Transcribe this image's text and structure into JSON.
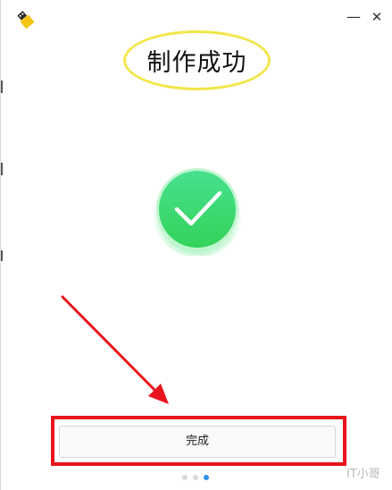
{
  "window": {
    "minimize_glyph": "—",
    "close_glyph": "✕",
    "app_icon": "usb-drive-icon"
  },
  "header": {
    "title": "制作成功"
  },
  "status": {
    "icon": "success-checkmark-icon",
    "color": "#3ddc6f"
  },
  "actions": {
    "finish_label": "完成"
  },
  "pager": {
    "total": 3,
    "current": 3
  },
  "annotations": {
    "title_highlight_color": "#f2e64a",
    "button_highlight_color": "#e8141c"
  },
  "watermark": {
    "text": "IT小哥"
  }
}
